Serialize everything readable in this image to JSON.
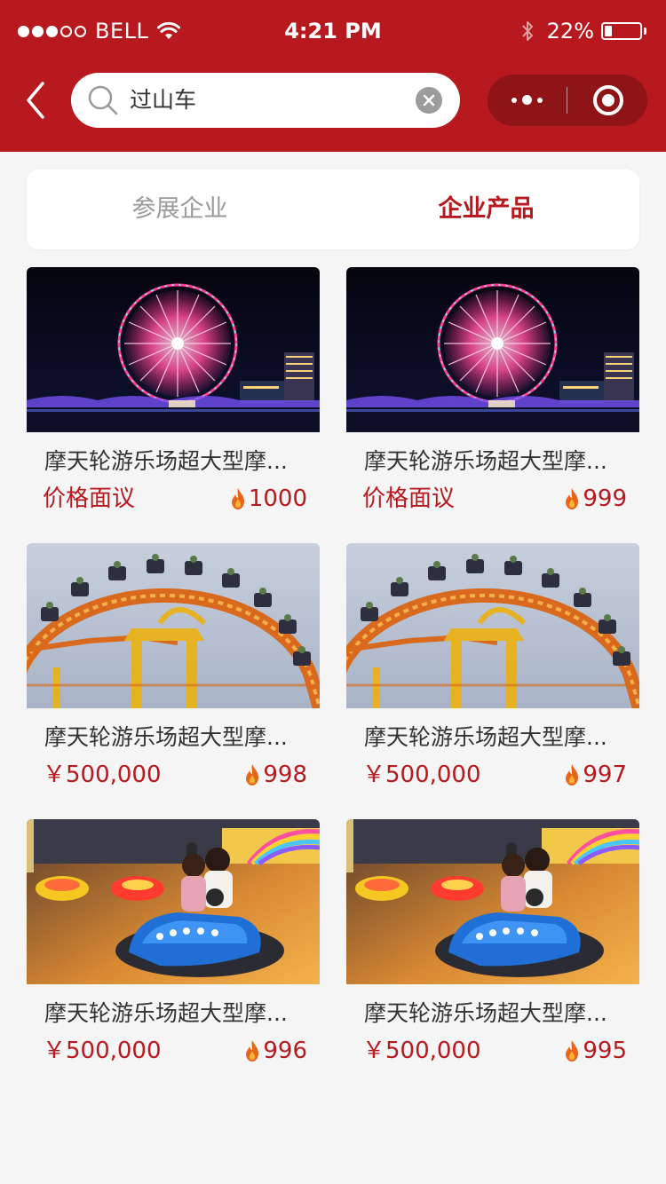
{
  "status_bar": {
    "carrier": "BELL",
    "time": "4:21 PM",
    "battery": "22%",
    "battery_level": 0.22
  },
  "search": {
    "query": "过山车",
    "placeholder": ""
  },
  "tabs": [
    {
      "label": "参展企业",
      "active": false
    },
    {
      "label": "企业产品",
      "active": true
    }
  ],
  "products": [
    {
      "title": "摩天轮游乐场超大型摩...",
      "price": "价格面议",
      "hot": "1000",
      "image": "ferris-wheel"
    },
    {
      "title": "摩天轮游乐场超大型摩...",
      "price": "价格面议",
      "hot": "999",
      "image": "ferris-wheel"
    },
    {
      "title": "摩天轮游乐场超大型摩...",
      "price": "￥500,000",
      "hot": "998",
      "image": "loop-ride"
    },
    {
      "title": "摩天轮游乐场超大型摩...",
      "price": "￥500,000",
      "hot": "997",
      "image": "loop-ride"
    },
    {
      "title": "摩天轮游乐场超大型摩...",
      "price": "￥500,000",
      "hot": "996",
      "image": "bumper-cars"
    },
    {
      "title": "摩天轮游乐场超大型摩...",
      "price": "￥500,000",
      "hot": "995",
      "image": "bumper-cars"
    }
  ],
  "colors": {
    "brand": "#b7191f",
    "capsule": "#8e1418",
    "background": "#f5f5f5"
  },
  "icons": {
    "back": "chevron-left-icon",
    "search": "search-icon",
    "clear": "clear-icon",
    "more": "more-icon",
    "close": "close-mini-program-icon",
    "hot": "flame-icon"
  }
}
